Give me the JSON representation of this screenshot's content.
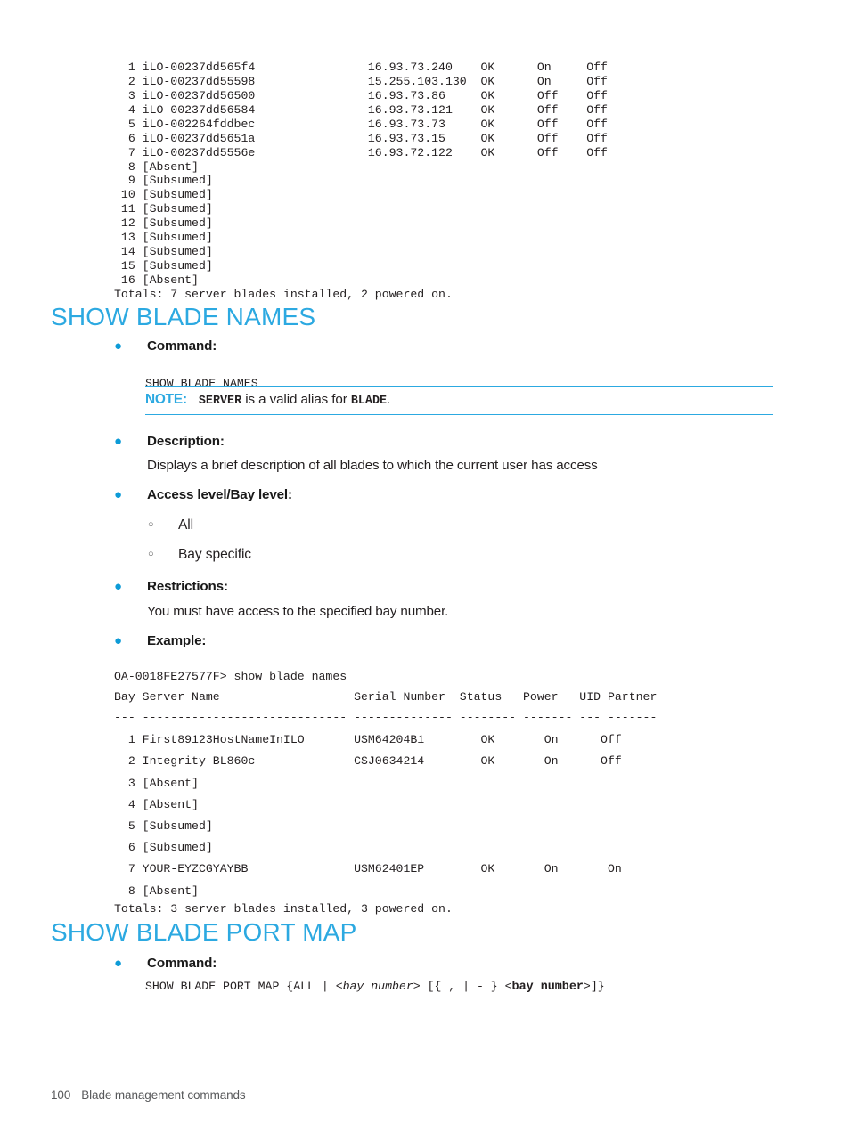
{
  "page": {
    "number": "100",
    "footer_title": "Blade management commands"
  },
  "colors": {
    "heading_blue": "#2CA9E1",
    "bullet_blue": "#0D9BD7",
    "note_blue": "#2CA9E1",
    "text": "#231f20"
  },
  "top_output": {
    "lines": [
      "  1 iLO-00237dd565f4                16.93.73.240    OK      On     Off",
      "  2 iLO-00237dd55598                15.255.103.130  OK      On     Off",
      "  3 iLO-00237dd56500                16.93.73.86     OK      Off    Off",
      "  4 iLO-00237dd56584                16.93.73.121    OK      Off    Off",
      "  5 iLO-002264fddbec                16.93.73.73     OK      Off    Off",
      "  6 iLO-00237dd5651a                16.93.73.15     OK      Off    Off",
      "  7 iLO-00237dd5556e                16.93.72.122    OK      Off    Off",
      "  8 [Absent]",
      "  9 [Subsumed]",
      " 10 [Subsumed]",
      " 11 [Subsumed]",
      " 12 [Subsumed]",
      " 13 [Subsumed]",
      " 14 [Subsumed]",
      " 15 [Subsumed]",
      " 16 [Absent]",
      "Totals: 7 server blades installed, 2 powered on."
    ],
    "rows": [
      {
        "bay": "1",
        "name": "iLO-00237dd565f4",
        "ip": "16.93.73.240",
        "status": "OK",
        "power": "On",
        "uid": "Off"
      },
      {
        "bay": "2",
        "name": "iLO-00237dd55598",
        "ip": "15.255.103.130",
        "status": "OK",
        "power": "On",
        "uid": "Off"
      },
      {
        "bay": "3",
        "name": "iLO-00237dd56500",
        "ip": "16.93.73.86",
        "status": "OK",
        "power": "Off",
        "uid": "Off"
      },
      {
        "bay": "4",
        "name": "iLO-00237dd56584",
        "ip": "16.93.73.121",
        "status": "OK",
        "power": "Off",
        "uid": "Off"
      },
      {
        "bay": "5",
        "name": "iLO-002264fddbec",
        "ip": "16.93.73.73",
        "status": "OK",
        "power": "Off",
        "uid": "Off"
      },
      {
        "bay": "6",
        "name": "iLO-00237dd5651a",
        "ip": "16.93.73.15",
        "status": "OK",
        "power": "Off",
        "uid": "Off"
      },
      {
        "bay": "7",
        "name": "iLO-00237dd5556e",
        "ip": "16.93.72.122",
        "status": "OK",
        "power": "Off",
        "uid": "Off"
      },
      {
        "bay": "8",
        "name": "[Absent]"
      },
      {
        "bay": "9",
        "name": "[Subsumed]"
      },
      {
        "bay": "10",
        "name": "[Subsumed]"
      },
      {
        "bay": "11",
        "name": "[Subsumed]"
      },
      {
        "bay": "12",
        "name": "[Subsumed]"
      },
      {
        "bay": "13",
        "name": "[Subsumed]"
      },
      {
        "bay": "14",
        "name": "[Subsumed]"
      },
      {
        "bay": "15",
        "name": "[Subsumed]"
      },
      {
        "bay": "16",
        "name": "[Absent]"
      }
    ],
    "totals": "Totals: 7 server blades installed, 2 powered on."
  },
  "section_names": {
    "heading": "SHOW BLADE NAMES",
    "command_label": "Command:",
    "command_syntax": "SHOW BLADE NAMES",
    "note": {
      "title": "NOTE:",
      "mono_first": "SERVER",
      "text_middle": " is a valid alias for ",
      "mono_second": "BLADE",
      "text_end": "."
    },
    "description_label": "Description:",
    "description_text": "Displays a brief description of all blades to which the current user has access",
    "access_label": "Access level/Bay level:",
    "access_items": [
      "All",
      "Bay specific"
    ],
    "restrictions_label": "Restrictions:",
    "restrictions_text": "You must have access to the specified bay number.",
    "example_label": "Example:",
    "example": {
      "prompt_line": "OA-0018FE27577F> show blade names",
      "header_line": "Bay Server Name                   Serial Number  Status   Power   UID Partner",
      "separator_line": "--- ----------------------------- -------------- -------- ------- --- -------",
      "lines": [
        "  1 First89123HostNameInILO       USM64204B1        OK       On      Off",
        "  2 Integrity BL860c              CSJ0634214        OK       On      Off",
        "  3 [Absent]",
        "  4 [Absent]",
        "  5 [Subsumed]",
        "  6 [Subsumed]",
        "  7 YOUR-EYZCGYAYBB               USM62401EP        OK       On       On",
        "  8 [Absent]"
      ],
      "columns": [
        "Bay",
        "Server Name",
        "Serial Number",
        "Status",
        "Power",
        "UID",
        "Partner"
      ],
      "rows": [
        {
          "bay": "1",
          "server_name": "First89123HostNameInILO",
          "serial": "USM64204B1",
          "status": "OK",
          "power": "On",
          "uid": "",
          "partner": "Off"
        },
        {
          "bay": "2",
          "server_name": "Integrity BL860c",
          "serial": "CSJ0634214",
          "status": "OK",
          "power": "On",
          "uid": "",
          "partner": "Off"
        },
        {
          "bay": "3",
          "server_name": "[Absent]"
        },
        {
          "bay": "4",
          "server_name": "[Absent]"
        },
        {
          "bay": "5",
          "server_name": "[Subsumed]"
        },
        {
          "bay": "6",
          "server_name": "[Subsumed]"
        },
        {
          "bay": "7",
          "server_name": "YOUR-EYZCGYAYBB",
          "serial": "USM62401EP",
          "status": "OK",
          "power": "On",
          "uid": "",
          "partner": "On"
        },
        {
          "bay": "8",
          "server_name": "[Absent]"
        }
      ],
      "totals": "Totals: 3 server blades installed, 3 powered on."
    }
  },
  "section_portmap": {
    "heading": "SHOW BLADE PORT MAP",
    "command_label": "Command:",
    "syntax": {
      "part1": "SHOW BLADE PORT MAP {ALL | ",
      "italic1": "<bay number>",
      "part2": " [{ , | - } <",
      "bold1": "bay number",
      "part3": ">]}"
    }
  }
}
